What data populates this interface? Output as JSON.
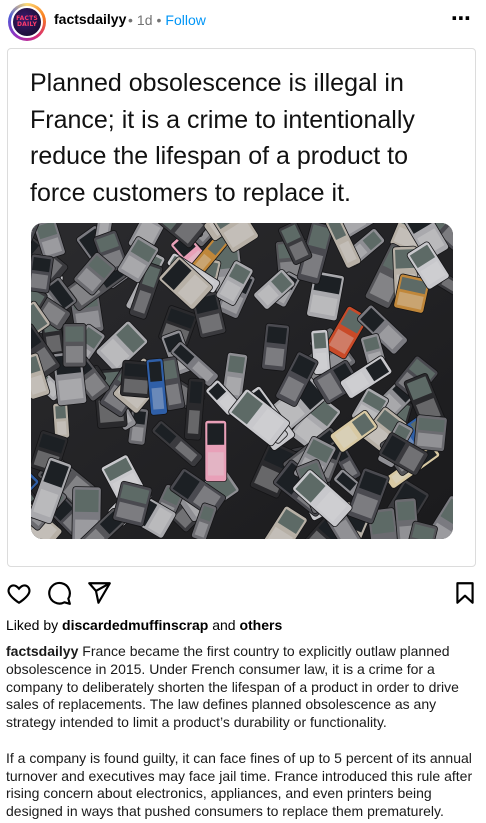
{
  "post": {
    "username": "factsdailyy",
    "time": "1d",
    "follow_label": "Follow",
    "avatar_text": "FACTS DAILY",
    "card_text": "Planned obsolescence is illegal in France; it is a crime to intentionally reduce the lifespan of a product to force customers to replace it."
  },
  "likes": {
    "prefix": "Liked by ",
    "user": "discardedmuffinscrap",
    "joiner": " and ",
    "others": "others"
  },
  "caption": {
    "username": "factsdailyy",
    "paragraph1": "France became the first country to explicitly outlaw planned obsolescence in 2015. Under French consumer law, it is a crime for a company to deliberately shorten the lifespan of a product in order to drive sales of replacements. The law defines planned obsolescence as any strategy intended to limit a product’s durability or functionality.",
    "paragraph2": "If a company is found guilty, it can face fines of up to 5 percent of its annual turnover and executives may face jail time. France introduced this rule after rising concern about electronics, appliances, and even printers being designed in ways that pushed consumers to replace them prematurely."
  },
  "icons": {
    "like": "heart-icon",
    "comment": "comment-icon",
    "share": "send-icon",
    "save": "bookmark-icon",
    "more": "more-icon"
  },
  "colors": {
    "follow": "#0095f6",
    "meta": "#737373"
  }
}
